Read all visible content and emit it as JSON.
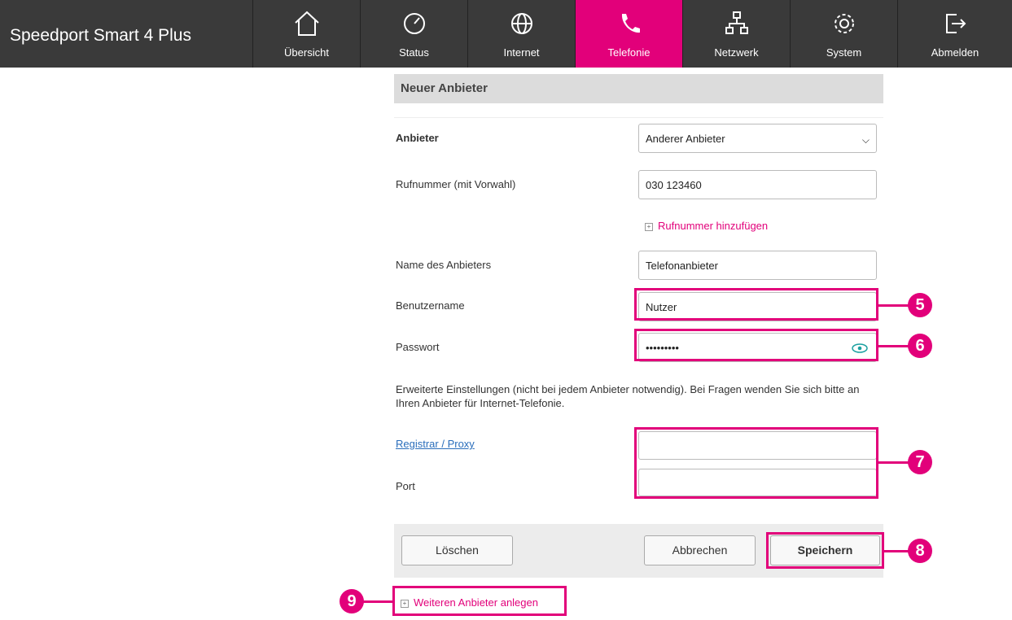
{
  "topbar": {
    "brand": "Speedport Smart 4 Plus",
    "nav": [
      {
        "label": "Übersicht",
        "icon": "home-icon"
      },
      {
        "label": "Status",
        "icon": "gauge-icon"
      },
      {
        "label": "Internet",
        "icon": "globe-icon"
      },
      {
        "label": "Telefonie",
        "icon": "phone-icon",
        "active": true
      },
      {
        "label": "Netzwerk",
        "icon": "network-icon"
      },
      {
        "label": "System",
        "icon": "gear-icon"
      },
      {
        "label": "Abmelden",
        "icon": "logout-icon"
      }
    ],
    "accent": "#e2007a"
  },
  "form": {
    "title": "Neuer Anbieter",
    "provider_label": "Anbieter",
    "provider_value": "Anderer Anbieter",
    "phone_label": "Rufnummer (mit Vorwahl)",
    "phone_value": "030 123460",
    "add_phone_link": "Rufnummer hinzufügen",
    "provider_name_label": "Name des Anbieters",
    "provider_name_value": "Telefonanbieter",
    "username_label": "Benutzername",
    "username_value": "Nutzer",
    "password_label": "Passwort",
    "password_value": "•••••••••",
    "advanced_note": "Erweiterte Einstellungen (nicht bei jedem Anbieter notwendig). Bei Fragen wenden Sie sich bitte an Ihren Anbieter für Internet-Telefonie.",
    "registrar_label": "Registrar / Proxy",
    "registrar_value": "",
    "port_label": "Port",
    "port_value": "",
    "delete_button": "Löschen",
    "cancel_button": "Abbrechen",
    "save_button": "Speichern",
    "add_provider_link": "Weiteren Anbieter anlegen"
  },
  "callouts": [
    "5",
    "6",
    "7",
    "8",
    "9"
  ]
}
